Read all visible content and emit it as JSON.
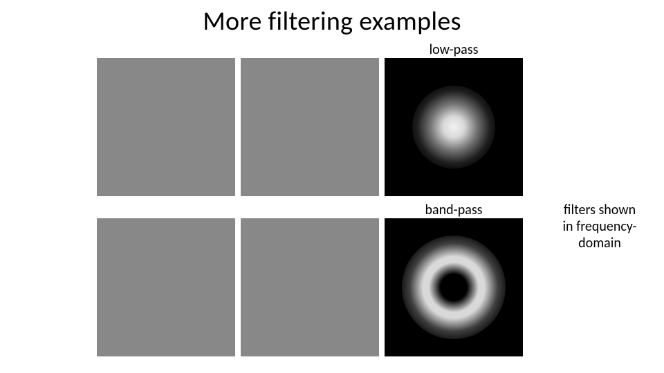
{
  "title": "More filtering examples",
  "row1": {
    "col1_caption": "",
    "col2_caption": "",
    "col3_caption": "low-pass"
  },
  "row2": {
    "col1_caption": "",
    "col2_caption": "",
    "col3_caption": "band-pass"
  },
  "sidenote_line1": "filters shown",
  "sidenote_line2": "in frequency-",
  "sidenote_line3": "domain",
  "images": {
    "row1_col1": "original-image-placeholder",
    "row1_col2": "lowpass-result-placeholder",
    "row1_col3": "lowpass-filter-spectrum",
    "row2_col1": "original-image-placeholder",
    "row2_col2": "bandpass-result-placeholder",
    "row2_col3": "bandpass-filter-spectrum"
  }
}
